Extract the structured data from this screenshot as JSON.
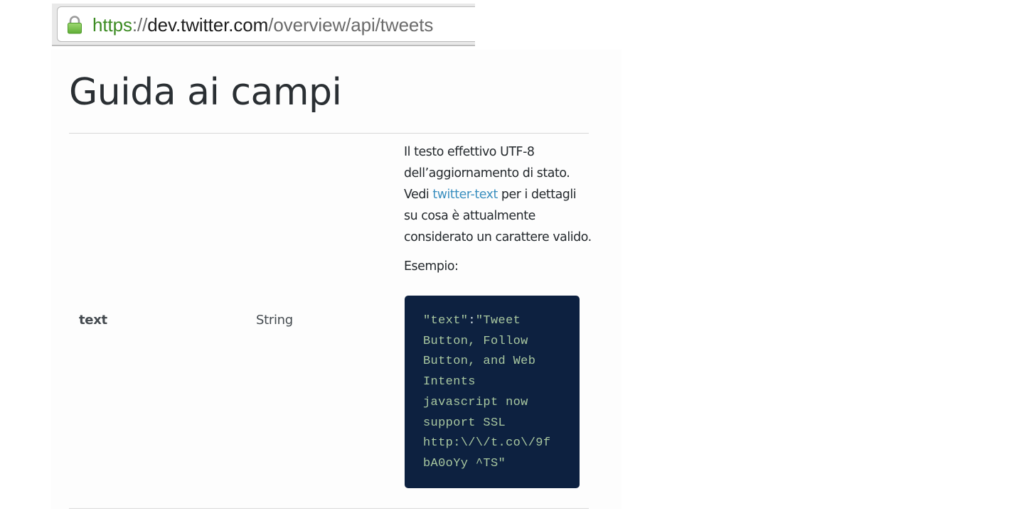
{
  "browser": {
    "url": {
      "scheme": "https",
      "separator": "://",
      "host": "dev.twitter.com",
      "path": "/overview/api/tweets"
    },
    "lock_icon": "lock-icon"
  },
  "page": {
    "title": "Guida ai campi"
  },
  "field": {
    "name": "text",
    "type": "String",
    "description": {
      "line1": "Il testo effettivo UTF-8",
      "line2": "dell’aggiornamento di stato.",
      "line3_before": "Vedi ",
      "line3_link": "twitter-text",
      "line3_after": " per i dettagli",
      "line4": "su cosa è attualmente",
      "line5": "considerato un carattere valido."
    },
    "example_label": "Esempio:",
    "example_code": {
      "key": "\"text\"",
      "colon": ":",
      "line1_rest": "\"Tweet",
      "lines": [
        "Button, Follow",
        "Button, and Web",
        "Intents",
        "javascript now",
        "support SSL",
        "http:\\/\\/t.co\\/9f",
        "bA0oYy ^TS\""
      ]
    }
  },
  "colors": {
    "link": "#3a8fbf",
    "code_background": "#0d2140",
    "code_text": "#a9c8a0",
    "url_scheme": "#3c8b22"
  }
}
